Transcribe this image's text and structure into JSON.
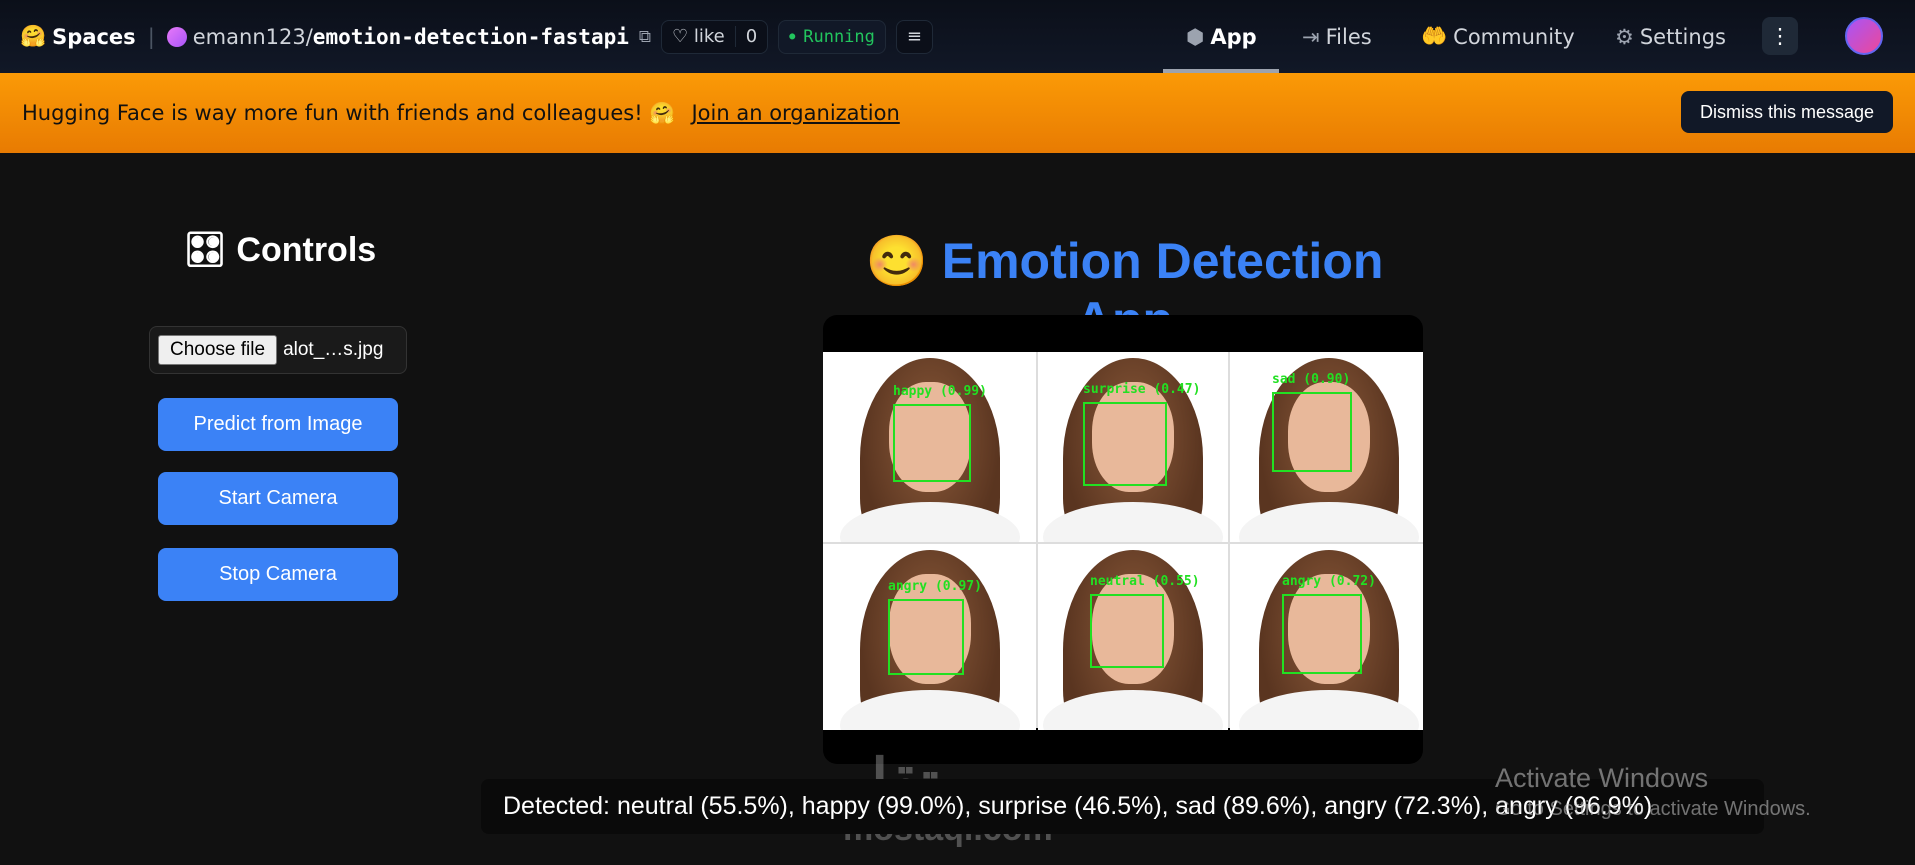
{
  "header": {
    "spaces": "Spaces",
    "owner": "emann123",
    "slash": "/",
    "repo": "emotion-detection-fastapi",
    "like": "like",
    "like_count": "0",
    "status": "Running",
    "nav": [
      {
        "label": "App",
        "icon": "cube-icon"
      },
      {
        "label": "Files",
        "icon": "files-icon"
      },
      {
        "label": "Community",
        "icon": "community-icon"
      },
      {
        "label": "Settings",
        "icon": "gear-icon"
      }
    ]
  },
  "banner": {
    "text": "Hugging Face is way more fun with friends and colleagues! 🤗",
    "link": "Join an organization",
    "dismiss": "Dismiss this message"
  },
  "controls": {
    "title": "🎛 Controls",
    "choose_file": "Choose file",
    "file_name": "alot_…s.jpg",
    "buttons": [
      "Predict from Image",
      "Start Camera",
      "Stop Camera"
    ]
  },
  "main": {
    "title": "😊 Emotion Detection App",
    "faces": [
      "happy (0.99)",
      "surprise (0.47)",
      "sad (0.90)",
      "angry (0.97)",
      "neutral (0.55)",
      "angry (0.72)"
    ],
    "detected": "Detected: neutral (55.5%), happy (99.0%), surprise (46.5%), sad (89.6%), angry (72.3%), angry (96.9%)"
  },
  "overlay": {
    "watermark_ar": "مستقل",
    "watermark": "mostaql.com",
    "activate_title": "Activate Windows",
    "activate_sub": "Go to Settings to activate Windows."
  },
  "colors": {
    "accent": "#3b82f6",
    "banner": "#f59e0b",
    "box": "#22e022"
  }
}
